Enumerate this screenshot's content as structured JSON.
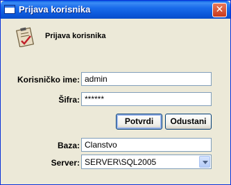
{
  "window": {
    "title": "Prijava korisnika",
    "close_glyph": "✕"
  },
  "header": {
    "title": "Prijava korisnika",
    "icon": "clipboard-check-icon"
  },
  "form": {
    "username_label": "Korisničko ime:",
    "username_value": "admin",
    "password_label": "Šifra:",
    "password_value": "******",
    "confirm_label": "Potvrdi",
    "cancel_label": "Odustani",
    "database_label": "Baza:",
    "database_value": "Clanstvo",
    "server_label": "Server:",
    "server_value": "SERVER\\SQL2005"
  }
}
